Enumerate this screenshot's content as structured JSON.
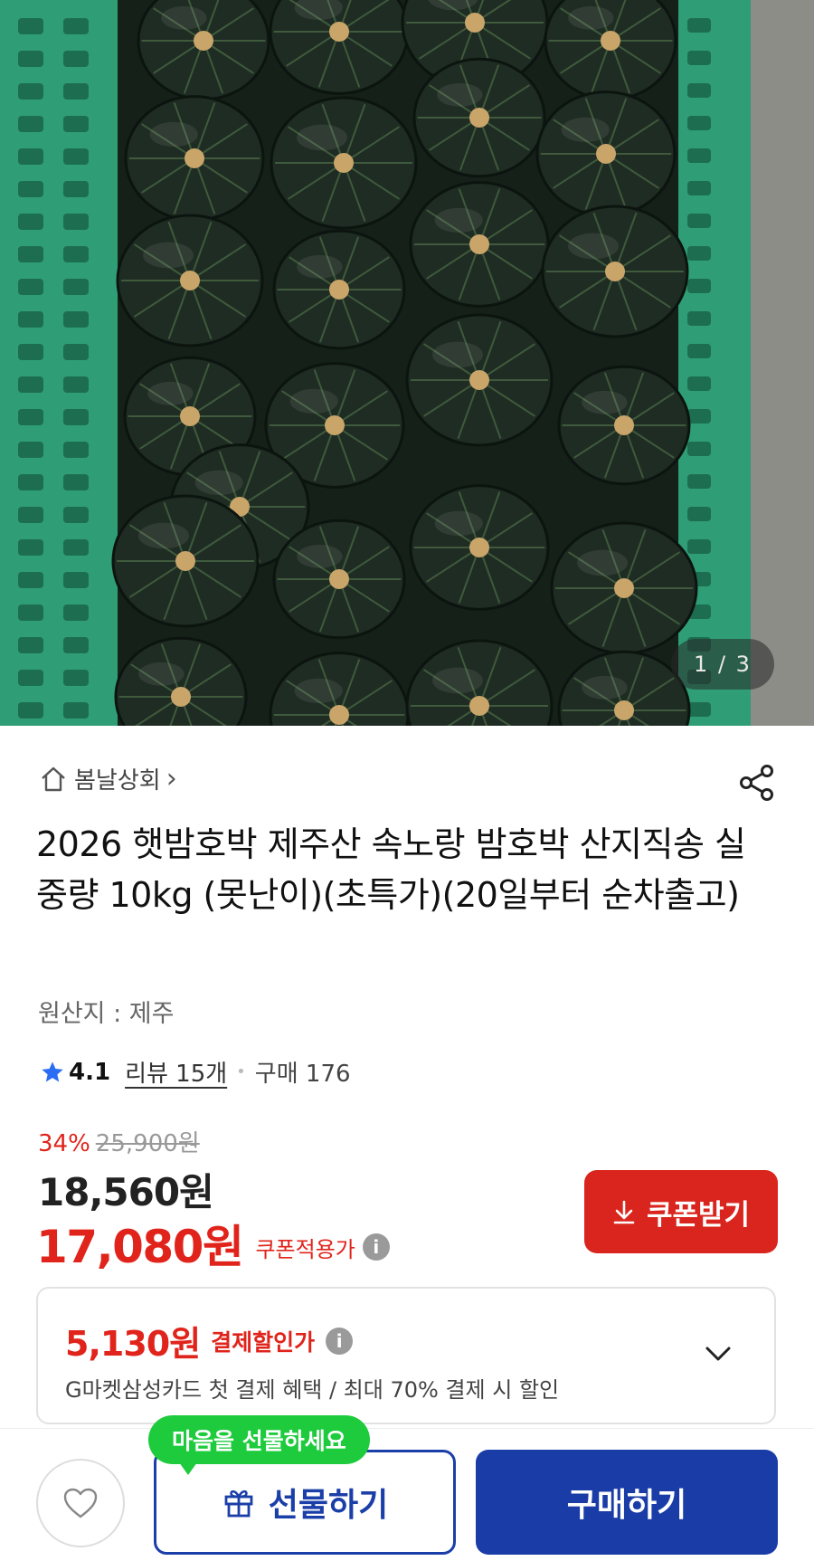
{
  "product_image": {
    "counter": "1 / 3",
    "colors": {
      "crate": "#2f9e76",
      "pumpkin": "#1f2c23",
      "stem": "#c9a56a"
    }
  },
  "store": {
    "name": "봄날상회",
    "chevron": "›"
  },
  "product": {
    "title": "2026 햇밤호박 제주산 속노랑 밤호박 산지직송 실중량 10kg (못난이)(초특가)(20일부터 순차출고)",
    "origin": "원산지 : 제주"
  },
  "rating": {
    "score": "4.1",
    "review_label": "리뷰 15개",
    "purchase_label": "구매 176"
  },
  "price": {
    "discount_pct": "34%",
    "original": "25,900원",
    "sale": "18,560원",
    "coupon_price": "17,080원",
    "coupon_note": "쿠폰적용가"
  },
  "coupon_button": {
    "label": "쿠폰받기"
  },
  "payment_discount": {
    "amount": "5,130원",
    "label": "결제할인가",
    "description": "G마켓삼성카드 첫 결제 혜택 / 최대 70% 결제 시 할인"
  },
  "bottom_bar": {
    "tooltip": "마음을 선물하세요",
    "gift_label": "선물하기",
    "buy_label": "구매하기"
  },
  "colors": {
    "accent_red": "#e0241b",
    "brand_blue": "#1a3ca7",
    "tooltip_green": "#1ecb3d"
  }
}
